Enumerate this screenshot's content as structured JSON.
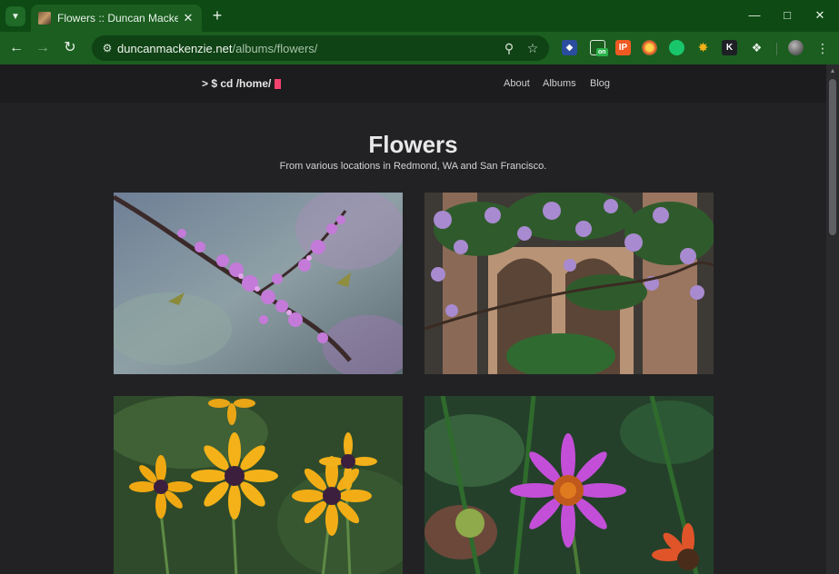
{
  "browser": {
    "tab_title": "Flowers :: Duncan Mackenzie",
    "url_host": "duncanmackenzie.net",
    "url_path": "/albums/flowers/",
    "icons": {
      "tab_list": "chevron-down-icon",
      "close": "close-icon",
      "new_tab": "plus-icon",
      "back": "arrow-left-icon",
      "forward": "arrow-right-icon",
      "reload": "reload-icon",
      "site_info": "tune-icon",
      "zoom": "magnifier-icon",
      "bookmark": "star-icon",
      "extensions": "puzzle-icon",
      "menu": "kebab-menu-icon"
    },
    "extension_badge": "on"
  },
  "site": {
    "logo_text": "> $ cd /home/",
    "cursor_color": "#f2436f",
    "nav": [
      {
        "label": "About"
      },
      {
        "label": "Albums"
      },
      {
        "label": "Blog"
      }
    ]
  },
  "album": {
    "title": "Flowers",
    "subtitle": "From various locations in Redmond, WA and San Francisco."
  },
  "colors": {
    "chrome_dark": "#0d4a14",
    "chrome_toolbar": "#1b5e20",
    "page_bg": "#222225",
    "header_bg": "#1c1c1e"
  }
}
